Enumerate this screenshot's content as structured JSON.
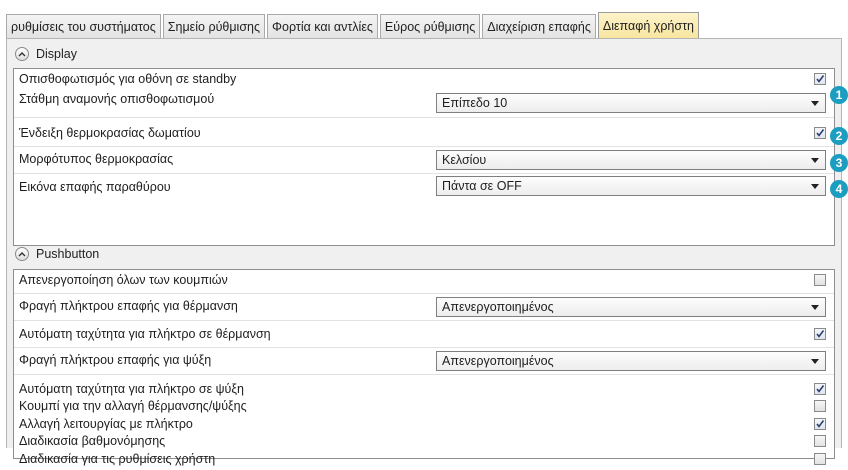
{
  "tabs": [
    {
      "label": "ρυθμίσεις του συστήματος",
      "active": false
    },
    {
      "label": "Σημείο ρύθμισης",
      "active": false
    },
    {
      "label": "Φορτία και αντλίες",
      "active": false
    },
    {
      "label": "Εύρος ρύθμισης",
      "active": false
    },
    {
      "label": "Διαχείριση επαφής",
      "active": false
    },
    {
      "label": "Διεπαφή χρήστη",
      "active": true
    }
  ],
  "display": {
    "title": "Display",
    "backlight_standby": {
      "label": "Οπισθοφωτισμός για οθόνη σε standby",
      "checked": true
    },
    "backlight_level": {
      "label": "Στάθμη αναμονής οπισθοφωτισμού",
      "value": "Επίπεδο 10"
    },
    "room_temp": {
      "label": "Ένδειξη θερμοκρασίας δωματίου",
      "checked": true
    },
    "temp_format": {
      "label": "Μορφότυπος θερμοκρασίας",
      "value": "Κελσίου"
    },
    "window_icon": {
      "label": "Εικόνα επαφής παραθύρου",
      "value": "Πάντα σε OFF"
    }
  },
  "markers": [
    "1",
    "2",
    "3",
    "4"
  ],
  "pushbutton": {
    "title": "Pushbutton",
    "disable_all": {
      "label": "Απενεργοποίηση όλων των κουμπιών",
      "checked": false
    },
    "lock_heating": {
      "label": "Φραγή πλήκτρου επαφής για θέρμανση",
      "value": "Απενεργοποιημένος"
    },
    "auto_speed_heating": {
      "label": "Αυτόματη ταχύτητα για πλήκτρο σε θέρμανση",
      "checked": true
    },
    "lock_cooling": {
      "label": "Φραγή πλήκτρου επαφής για ψύξη",
      "value": "Απενεργοποιημένος"
    },
    "auto_speed_cooling": {
      "label": "Αυτόματη ταχύτητα για πλήκτρο σε ψύξη",
      "checked": true
    },
    "heat_cool_switch": {
      "label": "Κουμπί για την αλλαγή θέρμανσης/ψύξης",
      "checked": false
    },
    "mode_change": {
      "label": "Αλλαγή λειτουργίας με πλήκτρο",
      "checked": true
    },
    "calibration": {
      "label": "Διαδικασία βαθμονόμησης",
      "checked": false
    },
    "user_settings": {
      "label": "Διαδικασία για τις ρυθμίσεις χρήστη",
      "checked": false
    }
  },
  "colors": {
    "active_tab": "#f7e59e",
    "marker": "#1d9dc0"
  }
}
